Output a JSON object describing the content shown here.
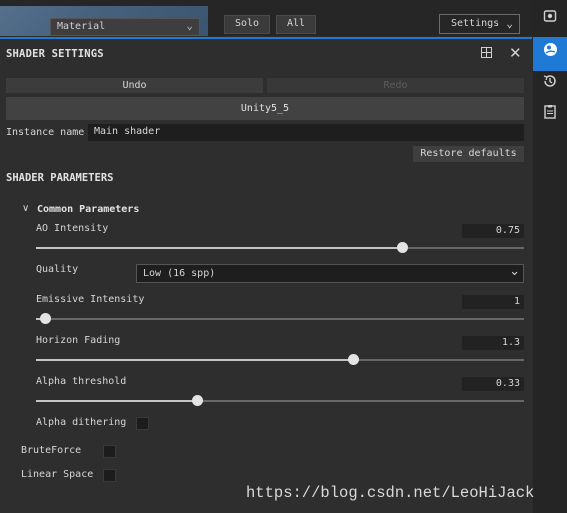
{
  "topbar": {
    "material_select": "Material",
    "solo_label": "Solo",
    "all_label": "All",
    "settings_label": "Settings"
  },
  "rail": {
    "icons": [
      "settings-icon",
      "globe-icon",
      "history-icon",
      "clipboard-icon"
    ],
    "active_color": "#1f7ad6"
  },
  "panel": {
    "title": "SHADER SETTINGS",
    "undo_label": "Undo",
    "redo_label": "Redo",
    "preset_label": "Unity5_5",
    "instance_label": "Instance name",
    "instance_value": "Main shader",
    "restore_label": "Restore defaults"
  },
  "params": {
    "title": "SHADER PARAMETERS",
    "group_title": "Common Parameters",
    "ao": {
      "label": "AO Intensity",
      "value": "0.75",
      "fraction": 0.75
    },
    "quality": {
      "label": "Quality",
      "value": "Low (16 spp)"
    },
    "emissive": {
      "label": "Emissive Intensity",
      "value": "1",
      "fraction": 0.02
    },
    "horizon": {
      "label": "Horizon Fading",
      "value": "1.3",
      "fraction": 0.65
    },
    "alpha": {
      "label": "Alpha threshold",
      "value": "0.33",
      "fraction": 0.33
    },
    "alpha_dither_label": "Alpha dithering",
    "bruteforce_label": "BruteForce",
    "linear_label": "Linear Space"
  },
  "watermark": "https://blog.csdn.net/LeoHiJack"
}
